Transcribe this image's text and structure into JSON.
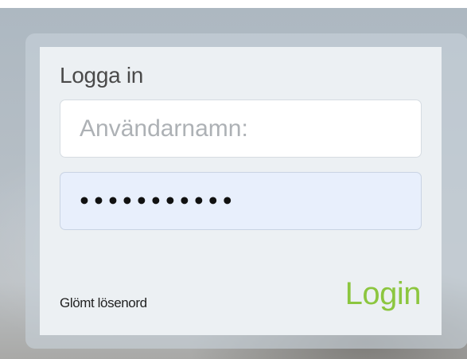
{
  "login_form": {
    "title": "Logga in",
    "username_placeholder": "Användarnamn:",
    "username_value": "",
    "password_value": "•••••••••••",
    "forgot_link": "Glömt lösenord",
    "submit_label": "Login"
  },
  "colors": {
    "accent": "#8cc63f",
    "panel_background": "#ecf0f3",
    "password_field_background": "#e8effc"
  }
}
